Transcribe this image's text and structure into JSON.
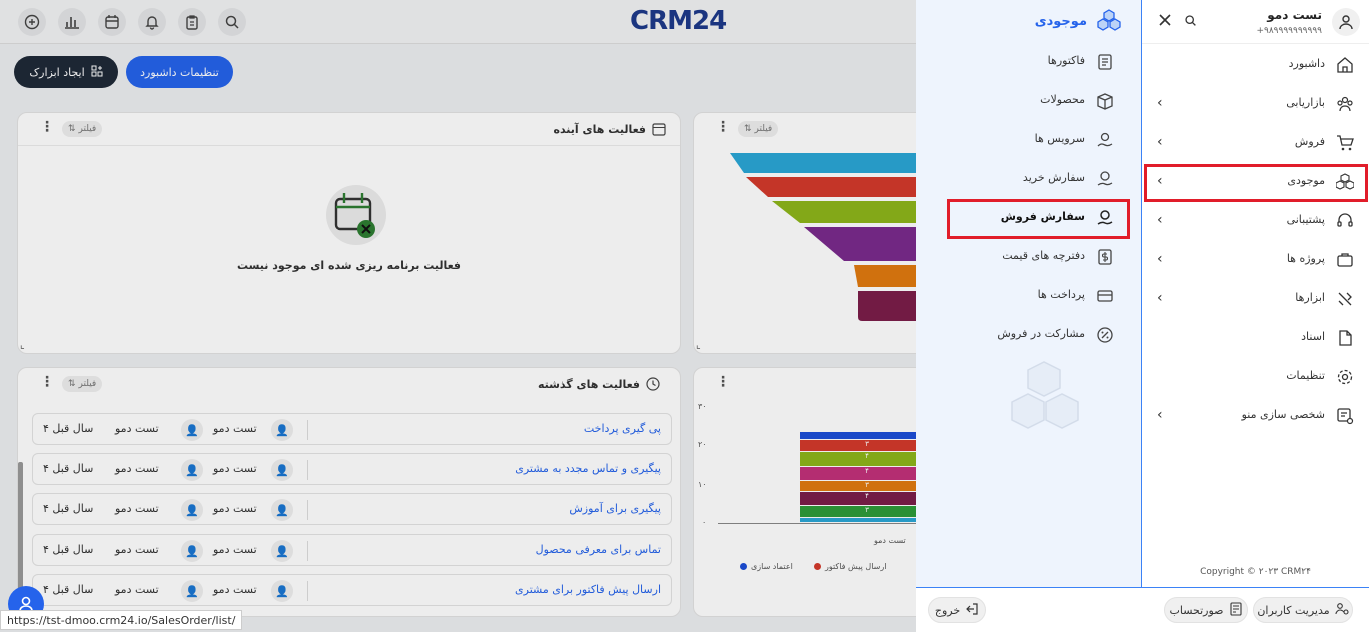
{
  "app": {
    "logo": "CRM24",
    "url_hint": "https://tst-dmoo.crm24.io/SalesOrder/list/"
  },
  "toolbar": {
    "dashboard_settings": "تنظیمات داشبورد",
    "create_widget": "ایجاد ابزارک"
  },
  "widgets": {
    "filter_label": "فیلتر",
    "upcoming": {
      "title": "فعالیت های آینده",
      "empty": "فعالیت برنامه ریزی شده ای موجود نیست"
    },
    "past": {
      "title": "فعالیت های گذشته",
      "rows": [
        {
          "title": "پی گیری پرداخت",
          "user1": "تست دمو",
          "user2": "تست دمو",
          "date": "۴ سال قبل"
        },
        {
          "title": "پیگیری و تماس مجدد به مشتری",
          "user1": "تست دمو",
          "user2": "تست دمو",
          "date": "۴ سال قبل"
        },
        {
          "title": "پیگیری برای آموزش",
          "user1": "تست دمو",
          "user2": "تست دمو",
          "date": "۴ سال قبل"
        },
        {
          "title": "تماس برای معرفی محصول",
          "user1": "تست دمو",
          "user2": "تست دمو",
          "date": "۴ سال قبل"
        },
        {
          "title": "ارسال پیش فاکتور برای مشتری",
          "user1": "تست دمو",
          "user2": "تست دمو",
          "date": "۴ سال قبل"
        }
      ]
    },
    "bar": {
      "yticks": [
        "۳۰",
        "۲۰",
        "۱۰",
        "۰"
      ],
      "xlabel": "تست دمو",
      "seg_labels": [
        "۳",
        "۴",
        "۴",
        "۳",
        "۴",
        "۳"
      ],
      "legend": [
        "اعتماد سازی",
        "ارسال پیش فاکتور"
      ]
    }
  },
  "colors": {
    "funnel": [
      "#2aa6d6",
      "#d33a2c",
      "#8db51a",
      "#7a2b8c",
      "#e07a10",
      "#7b1e4a"
    ],
    "accent": "#2563eb",
    "highlight": "#e11d2a"
  },
  "user": {
    "name": "تست دمو",
    "phone": "+۹۸۹۹۹۹۹۹۹۹۹۹"
  },
  "menu": [
    {
      "label": "داشبورد",
      "icon": "home-icon",
      "chevron": false
    },
    {
      "label": "بازاریابی",
      "icon": "users-icon",
      "chevron": true
    },
    {
      "label": "فروش",
      "icon": "cart-icon",
      "chevron": true
    },
    {
      "label": "موجودی",
      "icon": "boxes-icon",
      "chevron": true
    },
    {
      "label": "پشتیبانی",
      "icon": "headset-icon",
      "chevron": true
    },
    {
      "label": "پروژه ها",
      "icon": "briefcase-icon",
      "chevron": true
    },
    {
      "label": "ابزارها",
      "icon": "tools-icon",
      "chevron": true
    },
    {
      "label": "اسناد",
      "icon": "file-icon",
      "chevron": false
    },
    {
      "label": "تنظیمات",
      "icon": "gear-icon",
      "chevron": false
    },
    {
      "label": "شخصی سازی منو",
      "icon": "menu-custom-icon",
      "chevron": true
    }
  ],
  "copyright": "Copyright © ۲۰۲۳ CRM۲۴",
  "submenu": {
    "title": "موجودی",
    "items": [
      {
        "label": "فاکتورها",
        "icon": "invoice-icon"
      },
      {
        "label": "محصولات",
        "icon": "product-icon"
      },
      {
        "label": "سرویس ها",
        "icon": "service-icon"
      },
      {
        "label": "سفارش خرید",
        "icon": "purchase-order-icon"
      },
      {
        "label": "سفارش فروش",
        "icon": "sales-order-icon"
      },
      {
        "label": "دفترچه های قیمت",
        "icon": "pricebook-icon"
      },
      {
        "label": "پرداخت ها",
        "icon": "payment-icon"
      },
      {
        "label": "مشارکت در فروش",
        "icon": "percent-icon"
      }
    ]
  },
  "bottom": {
    "user_management": "مدیریت کاربران",
    "invoice": "صورتحساب",
    "logout": "خروج"
  }
}
